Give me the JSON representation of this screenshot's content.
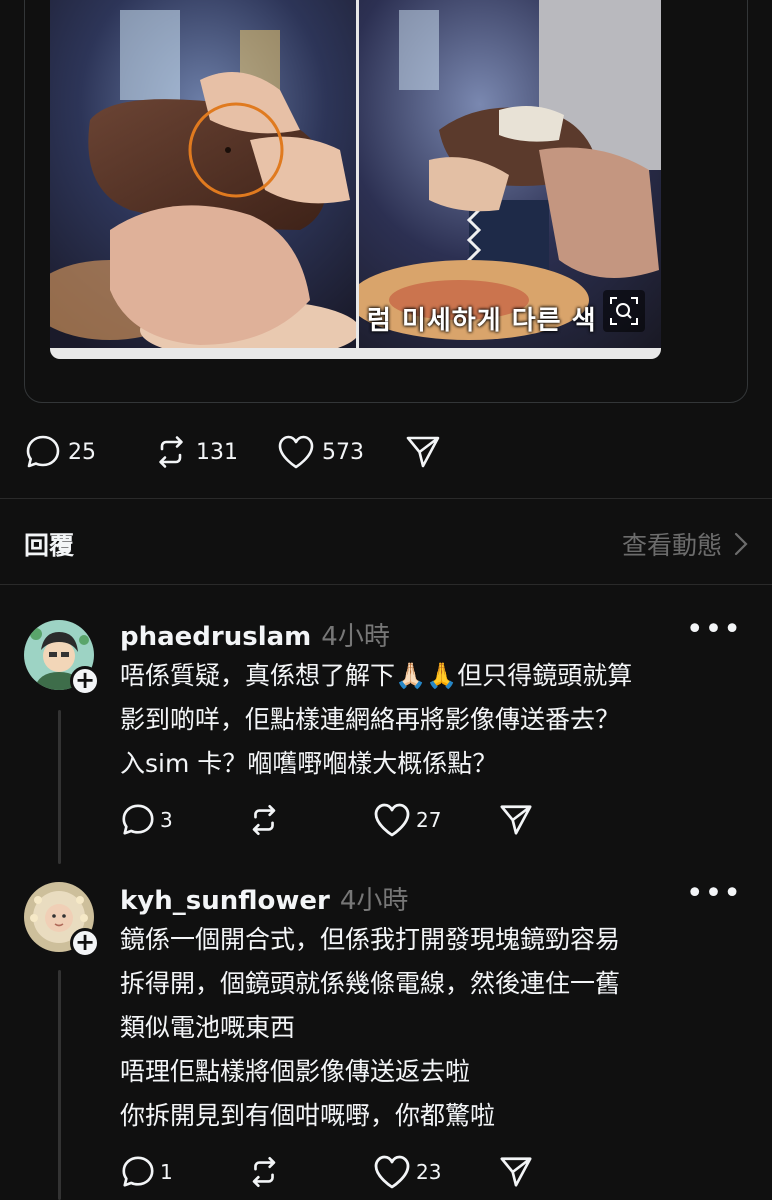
{
  "post": {
    "media": {
      "subtitle_overlay": "럼 미세하게 다른 색",
      "zoom_icon": "magnify-icon"
    },
    "stats": {
      "comments": "25",
      "reposts": "131",
      "likes": "573"
    }
  },
  "replies_header": {
    "title": "回覆",
    "view_activity": "查看動態"
  },
  "comments": [
    {
      "username": "phaedruslam",
      "time": "4小時",
      "lines": [
        "唔係質疑，真係想了解下🙏🏻🙏但只得鏡頭就算",
        "影到啲咩，佢點樣連網絡再將影像傳送番去？",
        "入sim 卡？嗰嚿嘢嗰樣大概係點？"
      ],
      "comments": "3",
      "likes": "27"
    },
    {
      "username": "kyh_sunflower",
      "time": "4小時",
      "lines": [
        "鏡係一個開合式，但係我打開發現塊鏡勁容易",
        "拆得開，個鏡頭就係幾條電線，然後連住一舊",
        "類似電池嘅東西",
        "唔理佢點樣將個影像傳送返去啦",
        "你拆開見到有個咁嘅嘢，你都驚啦"
      ],
      "comments": "1",
      "likes": "23"
    }
  ],
  "colors": {
    "background": "#101010",
    "text": "#f3f5f7",
    "muted": "#777777",
    "highlight_ring": "#e07a1f"
  }
}
